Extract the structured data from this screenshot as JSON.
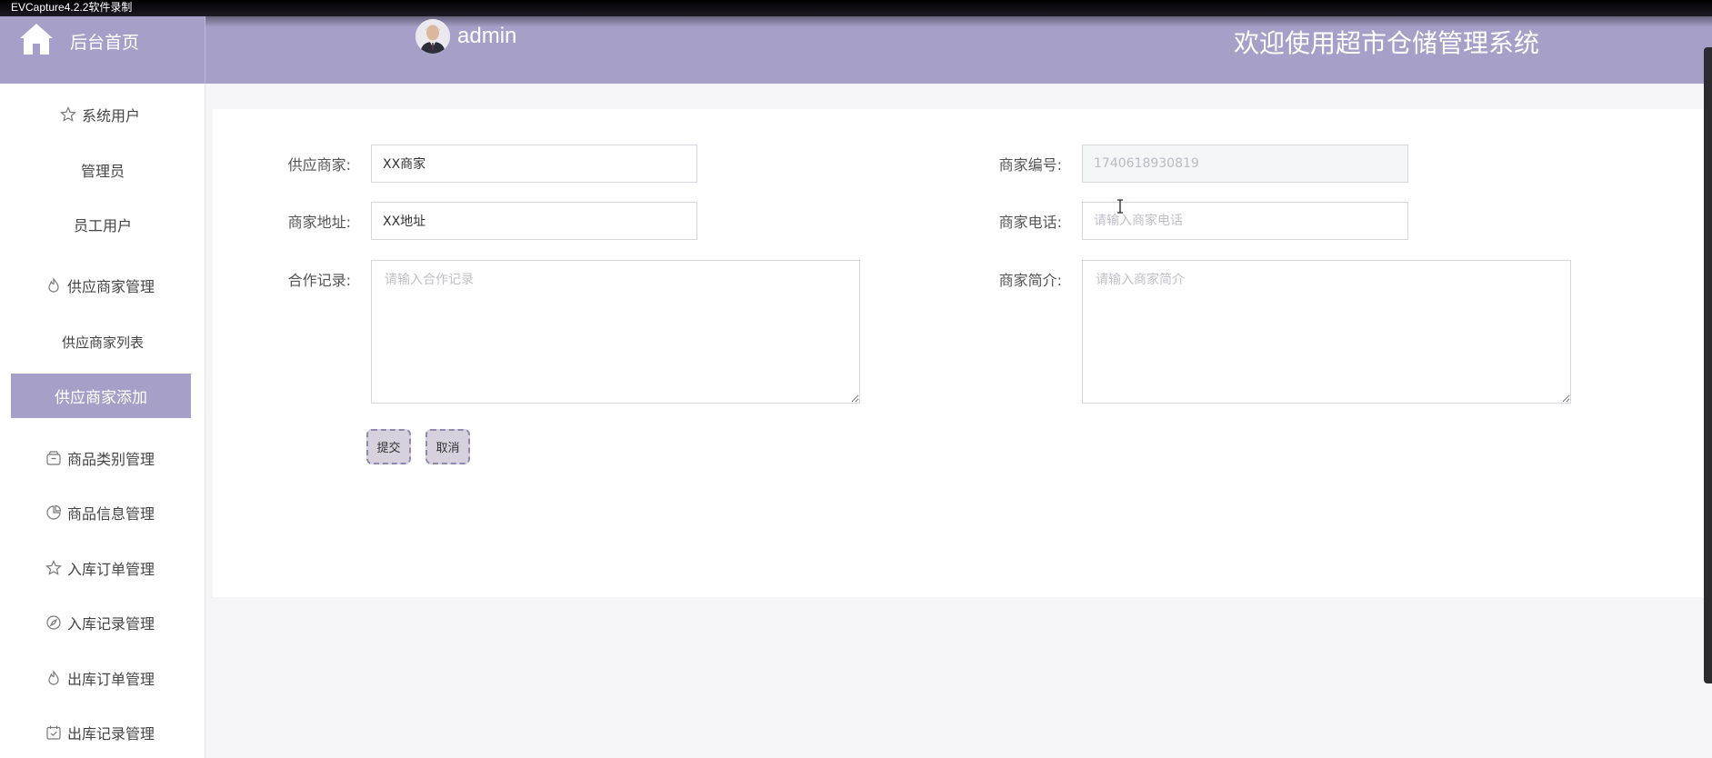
{
  "recorder": {
    "label": "EVCapture4.2.2软件录制"
  },
  "header": {
    "home_label": "后台首页",
    "user_name": "admin",
    "welcome": "欢迎使用超市仓储管理系统"
  },
  "sidebar": {
    "items": [
      {
        "label": "系统用户",
        "icon": "star-icon",
        "group": true
      },
      {
        "label": "管理员",
        "group": false
      },
      {
        "label": "员工用户",
        "group": false
      },
      {
        "label": "供应商家管理",
        "icon": "flame-icon",
        "group": true
      },
      {
        "label": "供应商家列表",
        "group": false
      },
      {
        "label": "供应商家添加",
        "group": false,
        "active": true
      },
      {
        "label": "商品类别管理",
        "icon": "box-icon",
        "group": true
      },
      {
        "label": "商品信息管理",
        "icon": "pie-icon",
        "group": true
      },
      {
        "label": "入库订单管理",
        "icon": "star-icon",
        "group": true
      },
      {
        "label": "入库记录管理",
        "icon": "compass-icon",
        "group": true
      },
      {
        "label": "出库订单管理",
        "icon": "flame-icon",
        "group": true
      },
      {
        "label": "出库记录管理",
        "icon": "calendar-check-icon",
        "group": true
      }
    ],
    "accent_color": "#a6a0c8"
  },
  "form": {
    "supplier_label": "供应商家:",
    "supplier_value": "XX商家",
    "code_label": "商家编号:",
    "code_value": "1740618930819",
    "address_label": "商家地址:",
    "address_value": "XX地址",
    "phone_label": "商家电话:",
    "phone_placeholder": "请输入商家电话",
    "record_label": "合作记录:",
    "record_placeholder": "请输入合作记录",
    "intro_label": "商家简介:",
    "intro_placeholder": "请输入商家简介",
    "submit_label": "提交",
    "cancel_label": "取消"
  }
}
